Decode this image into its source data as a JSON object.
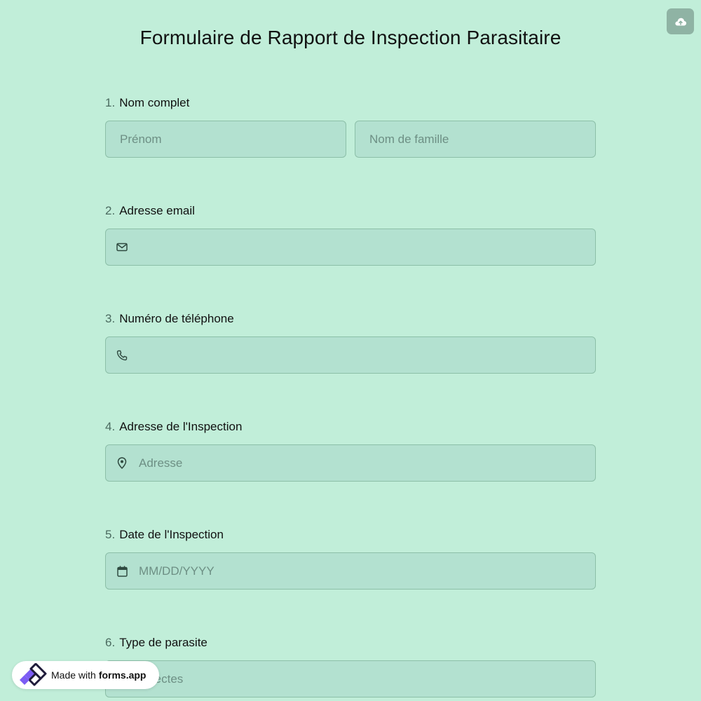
{
  "form": {
    "title": "Formulaire de Rapport de Inspection Parasitaire",
    "save_icon": "cloud-upload-icon",
    "questions": [
      {
        "number": "1.",
        "label": "Nom complet",
        "fields": [
          {
            "placeholder": "Prénom"
          },
          {
            "placeholder": "Nom de famille"
          }
        ]
      },
      {
        "number": "2.",
        "label": "Adresse email",
        "icon": "mail-icon",
        "placeholder": ""
      },
      {
        "number": "3.",
        "label": "Numéro de téléphone",
        "icon": "phone-icon",
        "placeholder": ""
      },
      {
        "number": "4.",
        "label": "Adresse de l'Inspection",
        "icon": "location-pin-icon",
        "placeholder": "Adresse"
      },
      {
        "number": "5.",
        "label": "Date de l'Inspection",
        "icon": "calendar-icon",
        "placeholder": "MM/DD/YYYY"
      },
      {
        "number": "6.",
        "label": "Type de parasite",
        "value": "Insectes"
      }
    ]
  },
  "badge": {
    "prefix": "Made with",
    "brand": "forms.app",
    "logo_icon": "forms-app-logo-icon"
  },
  "colors": {
    "background": "#c1eed9",
    "field_background": "#b3e1d0",
    "field_border": "#8cbfa8",
    "save_button": "#8fb3a4",
    "logo_purple": "#7c5cf4",
    "logo_dark": "#1f1b3a"
  }
}
